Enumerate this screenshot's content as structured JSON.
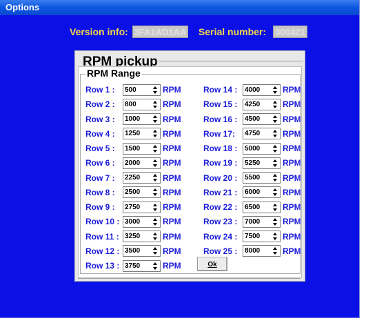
{
  "window": {
    "title": "Options"
  },
  "info": {
    "version_label": "Version info:",
    "version_value": "3FA1AD1AA",
    "serial_label": "Serial number:",
    "serial_value": "300421"
  },
  "dialog": {
    "title": "RPM pickup",
    "group_label": "RPM Range",
    "unit": "RPM",
    "ok_label": "Ok",
    "left_rows": [
      {
        "label": "Row  1 :",
        "value": "500"
      },
      {
        "label": "Row  2 :",
        "value": "800"
      },
      {
        "label": "Row  3 :",
        "value": "1000"
      },
      {
        "label": "Row  4 :",
        "value": "1250"
      },
      {
        "label": "Row  5 :",
        "value": "1500"
      },
      {
        "label": "Row  6 :",
        "value": "2000"
      },
      {
        "label": "Row  7 :",
        "value": "2250"
      },
      {
        "label": "Row  8 :",
        "value": "2500"
      },
      {
        "label": "Row  9 :",
        "value": "2750"
      },
      {
        "label": "Row 10 :",
        "value": "3000"
      },
      {
        "label": "Row 11 :",
        "value": "3250"
      },
      {
        "label": "Row 12 :",
        "value": "3500"
      },
      {
        "label": "Row 13 :",
        "value": "3750"
      }
    ],
    "right_rows": [
      {
        "label": "Row 14 :",
        "value": "4000"
      },
      {
        "label": "Row 15 :",
        "value": "4250"
      },
      {
        "label": "Row 16 :",
        "value": "4500"
      },
      {
        "label": "Row 17:",
        "value": "4750"
      },
      {
        "label": "Row 18 :",
        "value": "5000"
      },
      {
        "label": "Row 19 :",
        "value": "5250"
      },
      {
        "label": "Row 20 :",
        "value": "5500"
      },
      {
        "label": "Row 21 :",
        "value": "6000"
      },
      {
        "label": "Row 22 :",
        "value": "6500"
      },
      {
        "label": "Row 23 :",
        "value": "7000"
      },
      {
        "label": "Row 24 :",
        "value": "7500"
      },
      {
        "label": "Row 25 :",
        "value": "8000"
      }
    ]
  }
}
